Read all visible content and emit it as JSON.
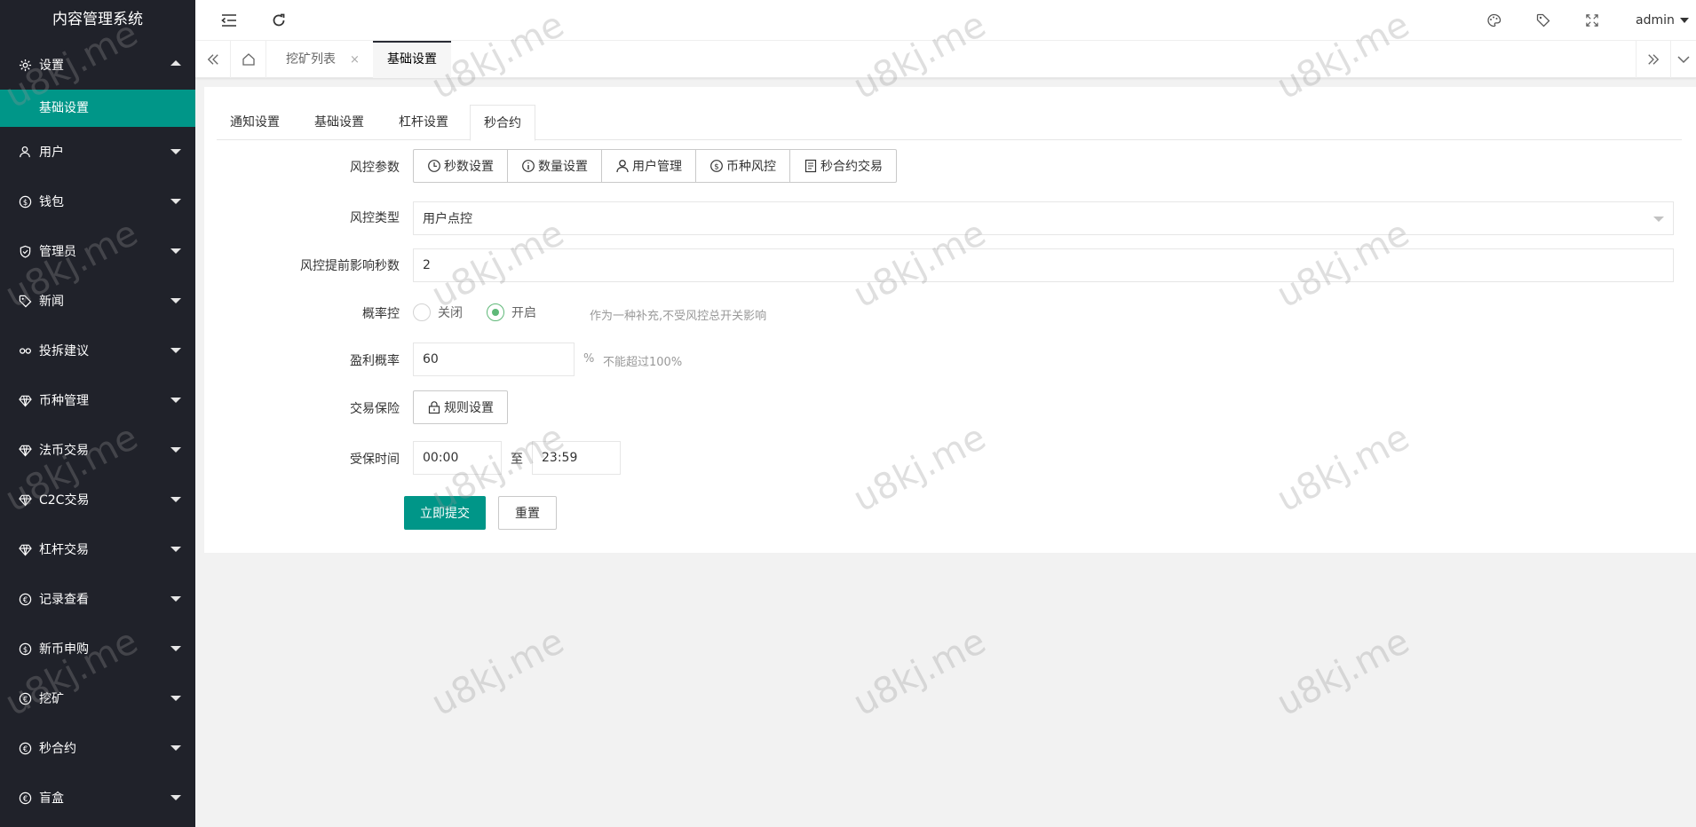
{
  "app_title": "内容管理系统",
  "sidebar": {
    "items": [
      {
        "label": "设置",
        "icon": "gear-icon",
        "expanded": true,
        "sub": [
          {
            "label": "基础设置",
            "active": true
          }
        ]
      },
      {
        "label": "用户",
        "icon": "user-icon"
      },
      {
        "label": "钱包",
        "icon": "dollar-icon"
      },
      {
        "label": "管理员",
        "icon": "shield-check-icon"
      },
      {
        "label": "新闻",
        "icon": "tag-icon"
      },
      {
        "label": "投拆建议",
        "icon": "link-icon"
      },
      {
        "label": "币种管理",
        "icon": "diamond-icon"
      },
      {
        "label": "法币交易",
        "icon": "diamond-icon"
      },
      {
        "label": "C2C交易",
        "icon": "diamond-icon"
      },
      {
        "label": "杠杆交易",
        "icon": "diamond-icon"
      },
      {
        "label": "记录查看",
        "icon": "euro-icon"
      },
      {
        "label": "新币申购",
        "icon": "dollar-icon"
      },
      {
        "label": "挖矿",
        "icon": "euro-icon"
      },
      {
        "label": "秒合约",
        "icon": "euro-icon"
      },
      {
        "label": "盲盒",
        "icon": "euro-icon"
      }
    ]
  },
  "header": {
    "user": "admin",
    "icons": [
      "menu-fold-icon",
      "refresh-icon",
      "theme-icon",
      "tag-icon",
      "fullscreen-icon"
    ]
  },
  "page_tabs": [
    {
      "label": "挖矿列表",
      "close": "×"
    },
    {
      "label": "基础设置",
      "active": true
    }
  ],
  "content_tabs": [
    {
      "label": "通知设置"
    },
    {
      "label": "基础设置"
    },
    {
      "label": "杠杆设置"
    },
    {
      "label": "秒合约",
      "active": true
    }
  ],
  "form": {
    "risk_params_label": "风控参数",
    "risk_params_buttons": [
      {
        "label": "秒数设置",
        "icon": "clock-icon"
      },
      {
        "label": "数量设置",
        "icon": "info-icon"
      },
      {
        "label": "用户管理",
        "icon": "user-icon"
      },
      {
        "label": "币种风控",
        "icon": "dollar-icon"
      },
      {
        "label": "秒合约交易",
        "icon": "list-icon"
      }
    ],
    "risk_type_label": "风控类型",
    "risk_type_value": "用户点控",
    "advance_seconds_label": "风控提前影响秒数",
    "advance_seconds_value": "2",
    "prob_control_label": "概率控",
    "prob_off": "关闭",
    "prob_on": "开启",
    "prob_hint": "作为一种补充,不受风控总开关影响",
    "profit_prob_label": "盈利概率",
    "profit_prob_value": "60",
    "profit_unit": "%",
    "profit_hint": "不能超过100%",
    "insurance_label": "交易保险",
    "insurance_button": "规则设置",
    "protect_time_label": "受保时间",
    "time_start": "00:00",
    "time_sep": "至",
    "time_end": "23:59",
    "submit": "立即提交",
    "reset": "重置"
  },
  "watermark": "u8kj.me",
  "colors": {
    "sidebar_bg": "#20222a",
    "accent": "#009688",
    "radio_on": "#5fb878"
  }
}
